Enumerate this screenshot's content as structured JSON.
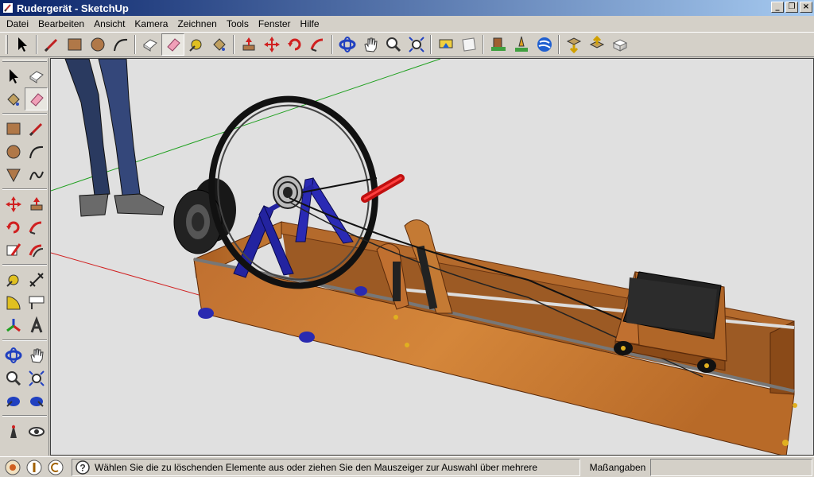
{
  "window": {
    "title": "Rudergerät - SketchUp"
  },
  "menu": [
    "Datei",
    "Bearbeiten",
    "Ansicht",
    "Kamera",
    "Zeichnen",
    "Tools",
    "Fenster",
    "Hilfe"
  ],
  "toolbar": {
    "items": [
      "select-arrow-icon",
      "pencil-line-icon",
      "rectangle-icon",
      "circle-icon",
      "arc-icon",
      "eraser-box-icon",
      "eraser-icon",
      "tape-measure-icon",
      "paint-bucket-icon",
      "push-pull-icon",
      "move-icon",
      "rotate-icon",
      "follow-me-icon",
      "orbit-icon",
      "pan-hand-icon",
      "zoom-icon",
      "zoom-extents-icon",
      "get-models-icon",
      "share-model-icon",
      "place-model-icon",
      "add-location-icon",
      "google-earth-icon",
      "upload-component-icon",
      "get-component-icon",
      "component-icon"
    ],
    "active": "eraser-icon"
  },
  "colors": {
    "title_start": "#0a246a",
    "title_end": "#a6caf0",
    "wood": "#c8762e",
    "frame_blue": "#2323a0",
    "axis_red": "#d02020",
    "axis_green": "#20a020"
  },
  "status": {
    "message": "Wählen Sie die zu löschenden Elemente aus oder ziehen Sie den Mauszeiger zur Auswahl über mehrere",
    "measurements_label": "Maßangaben",
    "measurements_value": ""
  }
}
